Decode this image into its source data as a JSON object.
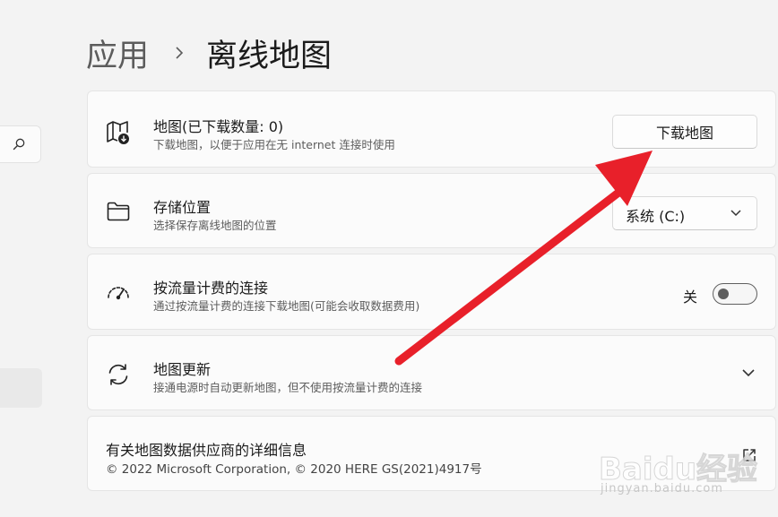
{
  "breadcrumb": {
    "parent": "应用",
    "current": "离线地图"
  },
  "sidebar": {
    "search_icon": "search-icon"
  },
  "maps_card": {
    "icon": "map-download-icon",
    "title": "地图(已下载数量: 0)",
    "description": "下载地图，以便于应用在无 internet 连接时使用",
    "button_label": "下载地图"
  },
  "storage_card": {
    "icon": "folder-icon",
    "title": "存储位置",
    "description": "选择保存离线地图的位置",
    "dropdown_value": "系统 (C:)"
  },
  "metered_card": {
    "icon": "gauge-icon",
    "title": "按流量计费的连接",
    "description": "通过按流量计费的连接下载地图(可能会收取数据费用)",
    "toggle_label": "关",
    "toggle_on": false
  },
  "updates_card": {
    "icon": "sync-icon",
    "title": "地图更新",
    "description": "接通电源时自动更新地图，但不使用按流量计费的连接"
  },
  "provider_card": {
    "title": "有关地图数据供应商的详细信息",
    "copyright": "© 2022 Microsoft Corporation, © 2020 HERE GS(2021)4917号"
  },
  "watermark": {
    "brand": "Baidu经验",
    "url": "jingyan.baidu.com"
  },
  "colors": {
    "annotation_arrow": "#e8202a",
    "page_background": "#f3f3f3",
    "card_background": "#fbfbfb"
  }
}
